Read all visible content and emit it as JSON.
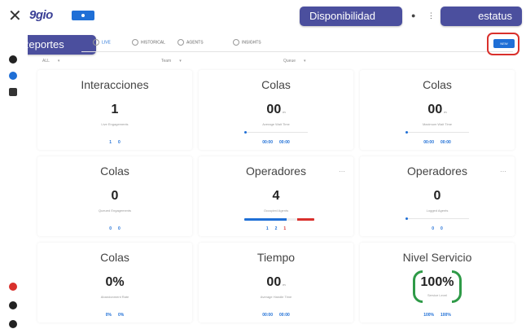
{
  "app": {
    "close_symbol": "✕",
    "logo_text": "9gio",
    "logo_color": "#3a3f96",
    "accent": "#1f6fd6",
    "highlight": "#d9302c"
  },
  "callouts": {
    "disponibilidad": "Disponibilidad",
    "estatus": "estatus",
    "reportes": "Reportes"
  },
  "tabs": [
    {
      "label": "Live",
      "icon": "dashboard-icon"
    },
    {
      "label": "Historical",
      "icon": "clock-icon"
    },
    {
      "label": "Agents",
      "icon": "person-icon"
    },
    {
      "label": "Insights",
      "icon": "chart-icon"
    }
  ],
  "filters": [
    {
      "label": "ALL"
    },
    {
      "label": "Team"
    },
    {
      "label": "Queue"
    }
  ],
  "top_button_label": "NEW",
  "cards": [
    {
      "title": "Interacciones",
      "value": "1",
      "sub": "Live Engagements",
      "stats": [
        "1",
        "0"
      ]
    },
    {
      "title": "Colas",
      "value": "00",
      "unit": "m",
      "sub": "Average Wait Time",
      "stats": [
        "00:00",
        "00:00"
      ],
      "slider": true
    },
    {
      "title": "Colas",
      "value": "00",
      "unit": "m",
      "sub": "Maximum Wait Time",
      "stats": [
        "00:00",
        "00:00"
      ],
      "slider": true
    },
    {
      "title": "Colas",
      "value": "0",
      "sub": "Queued Engagements",
      "stats": [
        "0",
        "0"
      ]
    },
    {
      "title": "Operadores",
      "value": "4",
      "sub": "Occupied Agents",
      "stats": [
        "1",
        "2",
        "1"
      ],
      "bar": {
        "blue": 0.6,
        "red": 0.25
      }
    },
    {
      "title": "Operadores",
      "value": "0",
      "sub": "Logged Agents",
      "stats": [
        "0",
        "0"
      ],
      "slider": true
    },
    {
      "title": "Colas",
      "value": "0%",
      "sub": "Abandonment Rate",
      "stats": [
        "0%",
        "0%"
      ]
    },
    {
      "title": "Tiempo",
      "value": "00",
      "unit": "m",
      "sub": "Average Handle Time",
      "stats": [
        "00:00",
        "00:00"
      ]
    },
    {
      "title": "Nivel Servicio",
      "value": "100%",
      "sub": "Service Level",
      "stats": [
        "100%",
        "100%"
      ],
      "gauge": true
    }
  ]
}
